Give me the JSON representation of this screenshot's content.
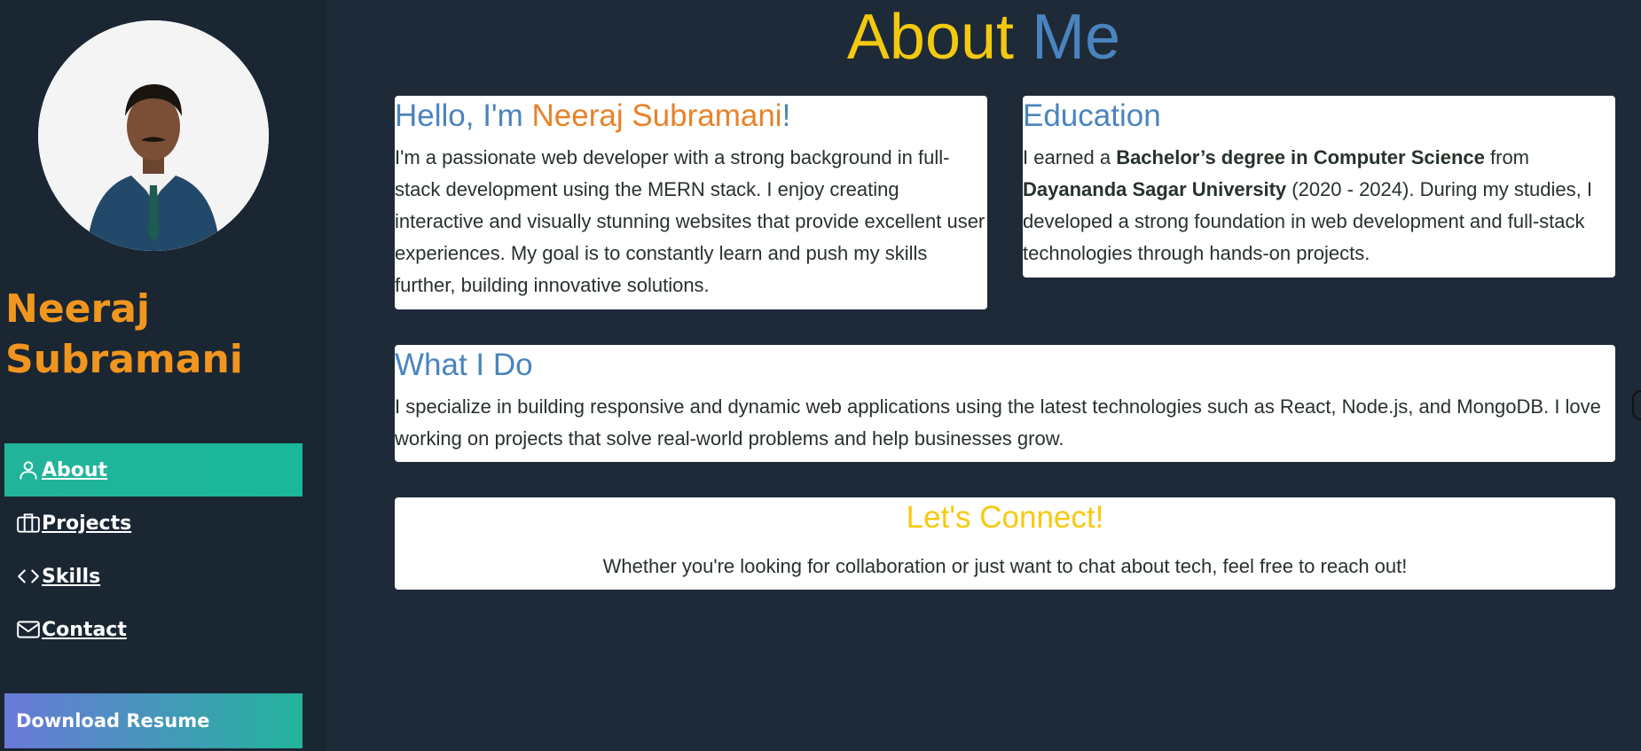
{
  "sidebar": {
    "name_line1": "Neeraj",
    "name_line2": "Subramani",
    "nav": [
      {
        "label": "About",
        "icon": "user-icon",
        "active": true
      },
      {
        "label": "Projects",
        "icon": "briefcase-icon",
        "active": false
      },
      {
        "label": "Skills",
        "icon": "code-icon",
        "active": false
      },
      {
        "label": "Contact",
        "icon": "mail-icon",
        "active": false
      }
    ],
    "download_label": "Download Resume"
  },
  "header": {
    "title_part1": "About",
    "title_part2": "Me"
  },
  "intro": {
    "heading_prefix": "Hello, I'm ",
    "heading_name": "Neeraj Subramani",
    "heading_suffix": "!",
    "body": "I'm a passionate web developer with a strong background in full-stack development using the MERN stack. I enjoy creating interactive and visually stunning websites that provide excellent user experiences. My goal is to constantly learn and push my skills further, building innovative solutions."
  },
  "education": {
    "heading": "Education",
    "text1": "I earned a ",
    "degree": "Bachelor’s degree in Computer Science",
    "text2": " from ",
    "university": "Dayananda Sagar University",
    "text3": " (2020 - 2024). During my studies, I developed a strong foundation in web development and full-stack technologies through hands-on projects."
  },
  "what_i_do": {
    "heading": "What I Do",
    "body": "I specialize in building responsive and dynamic web applications using the latest technologies such as React, Node.js, and MongoDB. I love working on projects that solve real-world problems and help businesses grow."
  },
  "connect": {
    "heading": "Let's Connect!",
    "body": "Whether you're looking for collaboration or just want to chat about tech, feel free to reach out!"
  },
  "colors": {
    "background": "#1e2a38",
    "accent_orange": "#f0961f",
    "accent_yellow": "#f2c90f",
    "accent_blue": "#4a84be",
    "active_nav": "#22b49b"
  }
}
